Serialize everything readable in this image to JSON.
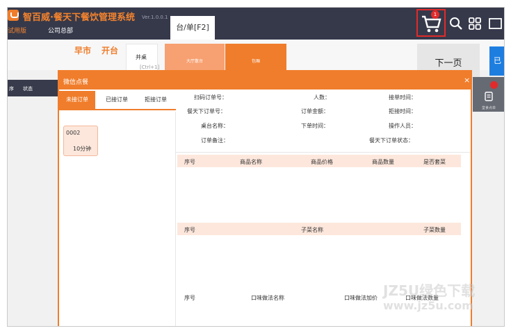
{
  "window": {
    "app_title": "智百威·餐天下餐饮管理系统",
    "version": "Ver.1.0.0.1",
    "trial": "试用版",
    "company": "公司总部",
    "active_tab": "台/单[F2]",
    "cart_count": "1"
  },
  "floor": {
    "morning": "早市",
    "open_table": "开台",
    "merge_label": "并桌",
    "merge_sub": "[Ctrl+1]",
    "hall_tab": "大厅散台",
    "room_tab": "包厢",
    "next_page": "下一页",
    "blue_btn": "已",
    "left_head": [
      "序",
      "状态"
    ]
  },
  "dialog": {
    "title": "微信点餐",
    "close": "×",
    "tabs": [
      "未接订单",
      "已接订单",
      "拒接订单"
    ],
    "order": {
      "no": "0002",
      "time": "10分钟"
    },
    "fields": {
      "scan_order_no": "扫码订单号：",
      "people": "人数：",
      "accept_time": "接单时间：",
      "ctx_order_no": "餐天下订单号：",
      "order_amount": "订单金额：",
      "reject_time": "拒接时间：",
      "table_name": "桌台名称：",
      "order_time": "下单时间：",
      "operator": "操作人员：",
      "remark": "订单备注：",
      "ctx_status": "餐天下订单状态："
    },
    "table1": [
      "序号",
      "商品名称",
      "商品价格",
      "商品数量",
      "是否套菜"
    ],
    "table2": [
      "序号",
      "子菜名称",
      "子菜数量"
    ],
    "table3": [
      "序号",
      "口味做法名称",
      "口味做法加价",
      "口味做法数量"
    ]
  },
  "float_widget": {
    "label": "堂食点单"
  },
  "watermark": {
    "line1": "JZ5U绿色下载",
    "line2": "www.jz5u.com"
  },
  "colors": {
    "accent": "#f07d2b",
    "topbar": "#36394a",
    "badge": "#e22a2a",
    "row_header": "#fde7dc"
  }
}
